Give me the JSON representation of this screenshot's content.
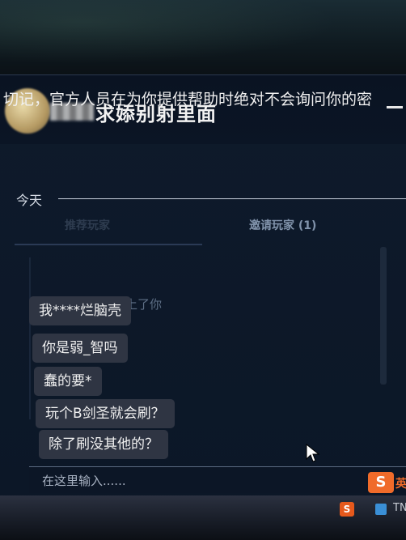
{
  "chat": {
    "title": "求婖别射里面",
    "warning": "切记，官方人员在为你提供帮助时绝对不会询问你的密",
    "today_label": "今天",
    "messages": [
      "我****烂脑壳",
      "你是弱_智吗",
      "蠢的要*",
      "玩个B剑圣就会刷？",
      "除了刷没其他的？"
    ],
    "input_placeholder": "在这里输入......"
  },
  "background_panel": {
    "tab_left": "推荐玩家",
    "tab_right": "邀请玩家 (1)",
    "ghost_text": "玩上了你"
  },
  "ime": {
    "logo": "S",
    "text": "英"
  },
  "taskbar": {
    "icon1_letter": "S",
    "text": "TN"
  },
  "colors": {
    "window_bg": "#0e1a2b",
    "bubble_bg": "#2f3543",
    "text": "#f1f1f1",
    "ime_accent": "#f06b2a"
  }
}
